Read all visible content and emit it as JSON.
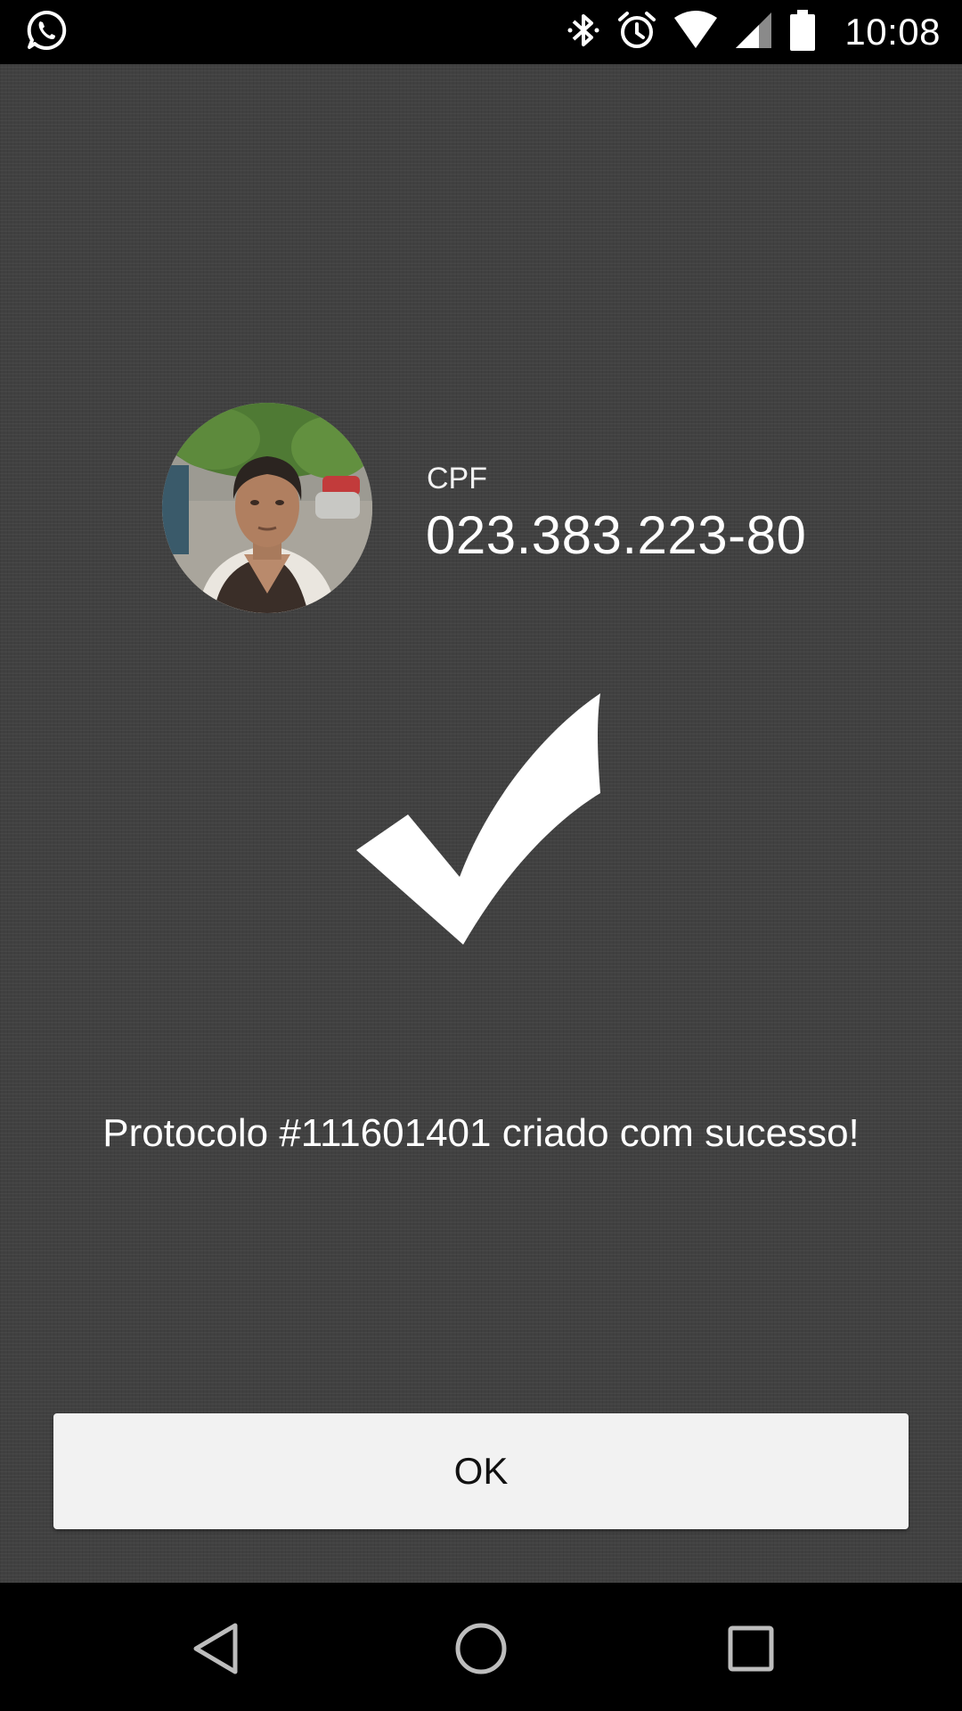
{
  "status_bar": {
    "time": "10:08",
    "icons": [
      "whatsapp-icon",
      "bluetooth-icon",
      "alarm-icon",
      "wifi-icon",
      "signal-icon",
      "battery-icon"
    ]
  },
  "profile": {
    "avatar": "person-photo",
    "cpf_label": "CPF",
    "cpf_value": "023.383.223-80"
  },
  "success": {
    "icon": "checkmark-icon",
    "message": "Protocolo #111601401 criado com sucesso!"
  },
  "actions": {
    "ok_label": "OK"
  },
  "nav_bar": {
    "buttons": [
      "back-icon",
      "home-icon",
      "recents-icon"
    ]
  },
  "colors": {
    "background": "#414141",
    "button_bg": "#f2f2f2",
    "text": "#ffffff"
  }
}
